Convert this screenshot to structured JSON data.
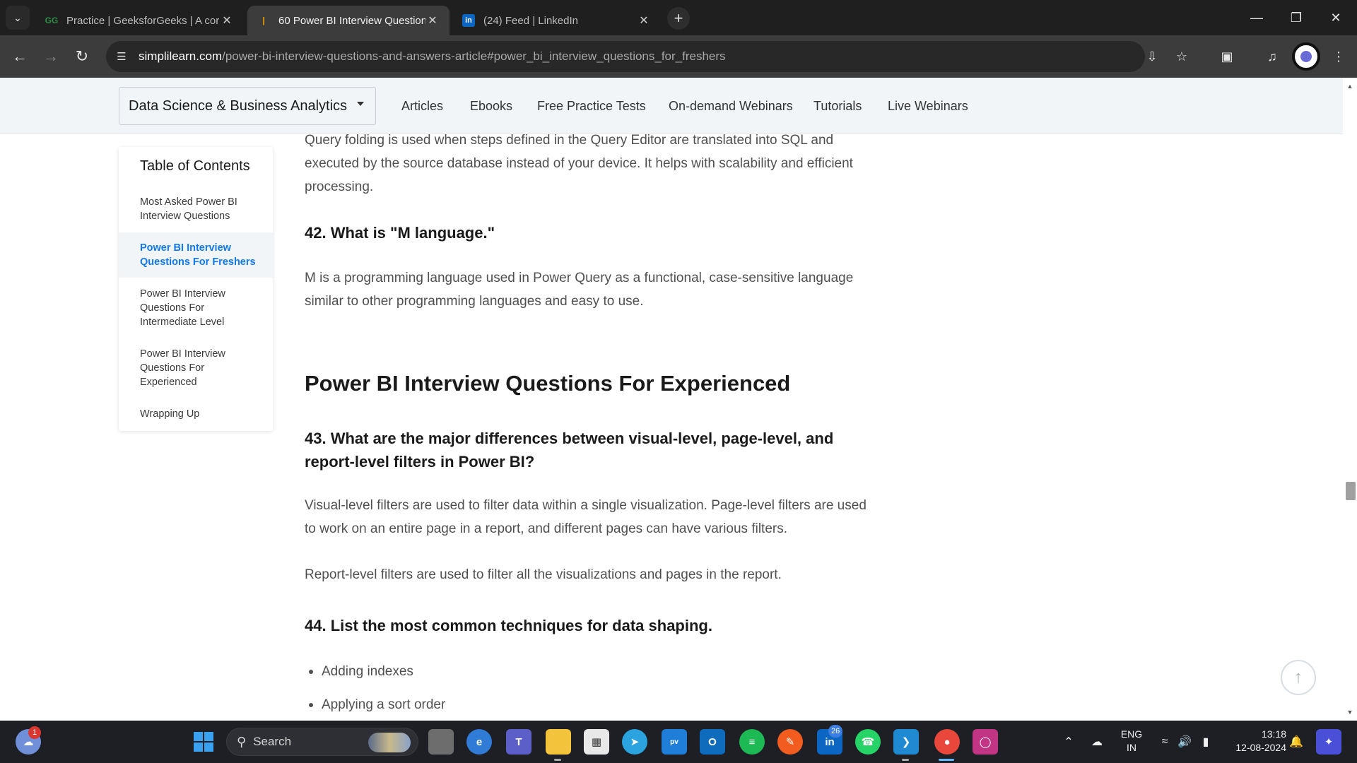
{
  "browser": {
    "tabs": [
      {
        "title": "Practice | GeeksforGeeks | A cor",
        "favicon": "geeksforgeeks-icon",
        "active": false
      },
      {
        "title": "60 Power BI Interview Question",
        "favicon": "simplilearn-icon",
        "active": true
      },
      {
        "title": "(24) Feed | LinkedIn",
        "favicon": "linkedin-icon",
        "active": false
      }
    ],
    "url_host": "simplilearn.com",
    "url_path": "/power-bi-interview-questions-and-answers-article#power_bi_interview_questions_for_freshers"
  },
  "site_nav": {
    "category": "Data Science & Business Analytics",
    "links": [
      "Articles",
      "Ebooks",
      "Free Practice Tests",
      "On-demand Webinars",
      "Tutorials",
      "Live Webinars"
    ]
  },
  "toc": {
    "title": "Table of Contents",
    "items": [
      {
        "label": "Most Asked Power BI Interview Questions",
        "active": false
      },
      {
        "label": "Power BI Interview Questions For Freshers",
        "active": true
      },
      {
        "label": "Power BI Interview Questions For Intermediate Level",
        "active": false
      },
      {
        "label": "Power BI Interview Questions For Experienced",
        "active": false
      },
      {
        "label": "Wrapping Up",
        "active": false
      }
    ]
  },
  "article": {
    "intro": "Query folding is used when steps defined in the Query Editor are translated into SQL and executed by the source database instead of your device. It helps with scalability and efficient processing.",
    "q42_title": "42. What is \"M language.\"",
    "q42_answer": "M is a programming language used in Power Query as a functional, case-sensitive language similar to other programming languages and easy to use.",
    "section_title": "Power BI Interview Questions For Experienced",
    "q43_title": "43. What are the major differences between visual-level, page-level, and report-level filters in Power BI?",
    "q43_answer_1": "Visual-level filters are used to filter data within a single visualization. Page-level filters are used to work on an entire page in a report, and different pages can have various filters.",
    "q43_answer_2": "Report-level filters are used to filter all the visualizations and pages in the report.",
    "q44_title": "44. List the most common techniques for data shaping.",
    "q44_items": [
      "Adding indexes",
      "Applying a sort order"
    ]
  },
  "taskbar": {
    "search_placeholder": "Search",
    "weather_badge": "1",
    "linkedin_badge": "26",
    "lang_primary": "ENG",
    "lang_secondary": "IN",
    "time": "13:18",
    "date": "12-08-2024"
  },
  "colors": {
    "accent_link": "#1179ef",
    "tab_strip": "#1f1f1f",
    "toolbar": "#3c3c3c",
    "site_nav_bg": "#f1f5f8",
    "taskbar": "#1d1f24"
  }
}
